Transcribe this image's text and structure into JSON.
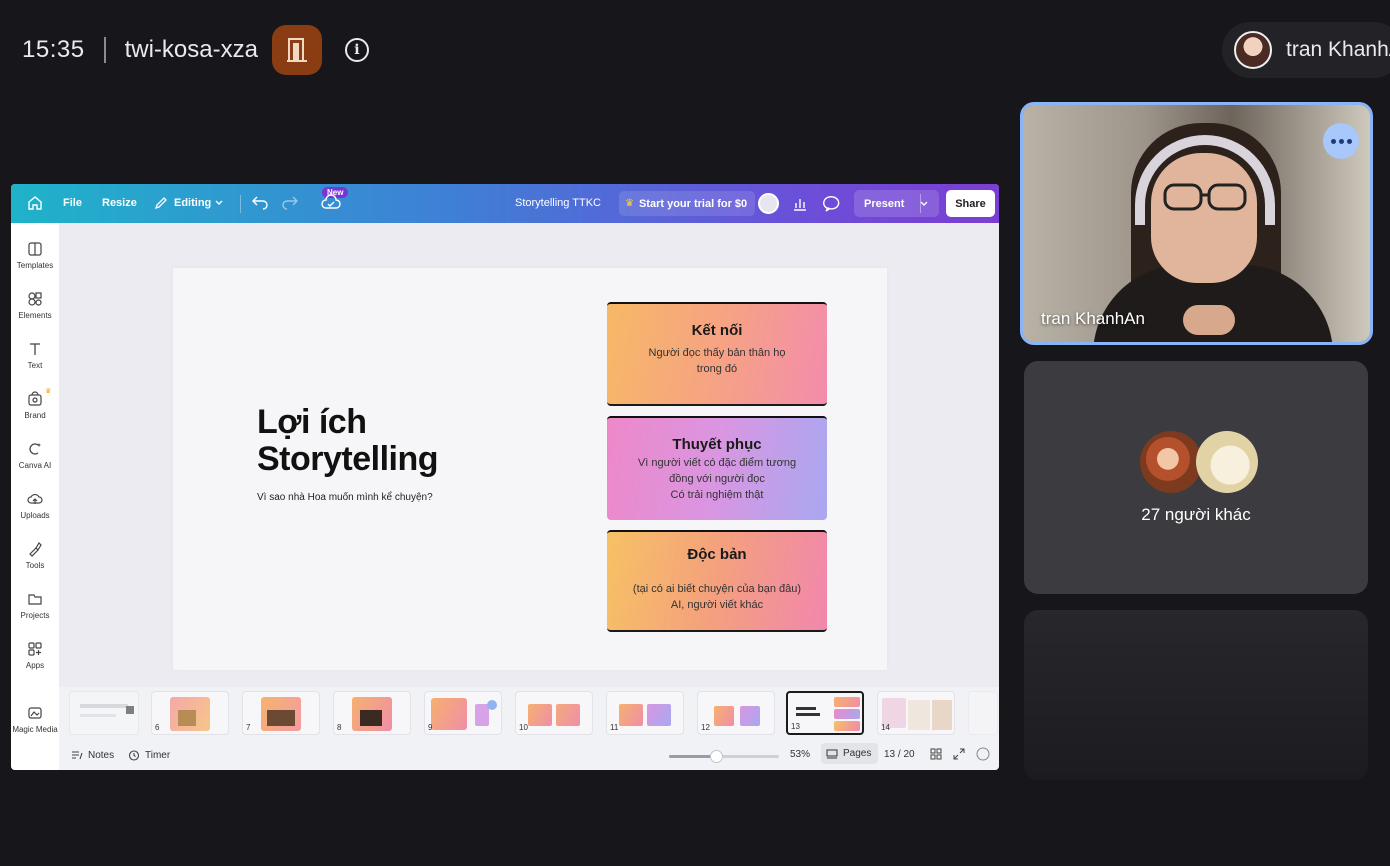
{
  "meet": {
    "time": "15:35",
    "meeting_code": "twi-kosa-xza",
    "presenter_name": "tran KhanhAn",
    "icons": {
      "door": "door-icon",
      "info": "info-icon"
    },
    "accent": "#8ab4f8"
  },
  "canva": {
    "toolbar": {
      "home": "home-icon",
      "file": "File",
      "resize": "Resize",
      "editing": "Editing",
      "new_badge": "New",
      "doc_title": "Storytelling TTKC",
      "trial": "Start your trial for $0",
      "present": "Present",
      "share": "Share"
    },
    "sidebar": [
      {
        "label": "Templates",
        "icon": "templates-icon"
      },
      {
        "label": "Elements",
        "icon": "elements-icon"
      },
      {
        "label": "Text",
        "icon": "text-icon"
      },
      {
        "label": "Brand",
        "icon": "brand-icon"
      },
      {
        "label": "Canva AI",
        "icon": "canva-ai-icon"
      },
      {
        "label": "Uploads",
        "icon": "uploads-icon"
      },
      {
        "label": "Tools",
        "icon": "tools-icon"
      },
      {
        "label": "Projects",
        "icon": "projects-icon"
      },
      {
        "label": "Apps",
        "icon": "apps-icon"
      },
      {
        "label": "Magic Media",
        "icon": "magic-media-icon"
      }
    ],
    "slide": {
      "title": "Lợi ích Storytelling",
      "subtitle": "Vì sao nhà Hoa muốn mình kể chuyện?",
      "cards": [
        {
          "title": "Kết nối",
          "lines": [
            "Người đọc thấy bản thân họ",
            "trong đó"
          ]
        },
        {
          "title": "Thuyết phục",
          "lines": [
            "Vì người viết có đặc điểm tương",
            "đồng với người đọc",
            "Có trải nghiệm thật"
          ]
        },
        {
          "title": "Độc bản",
          "lines": [
            "(tại có ai biết chuyện của bạn đâu)",
            "AI, người viết khác"
          ]
        }
      ]
    },
    "pages": {
      "thumbnails": [
        "6",
        "7",
        "8",
        "9",
        "10",
        "11",
        "12",
        "13",
        "14"
      ],
      "active": "13"
    },
    "bottombar": {
      "notes": "Notes",
      "timer": "Timer",
      "zoom": "53%",
      "zoom_fraction": 0.43,
      "pages_label": "Pages",
      "page_counter": "13 / 20"
    }
  },
  "participants": {
    "main_name": "tran KhanhAn",
    "others_label": "27 người khác"
  }
}
